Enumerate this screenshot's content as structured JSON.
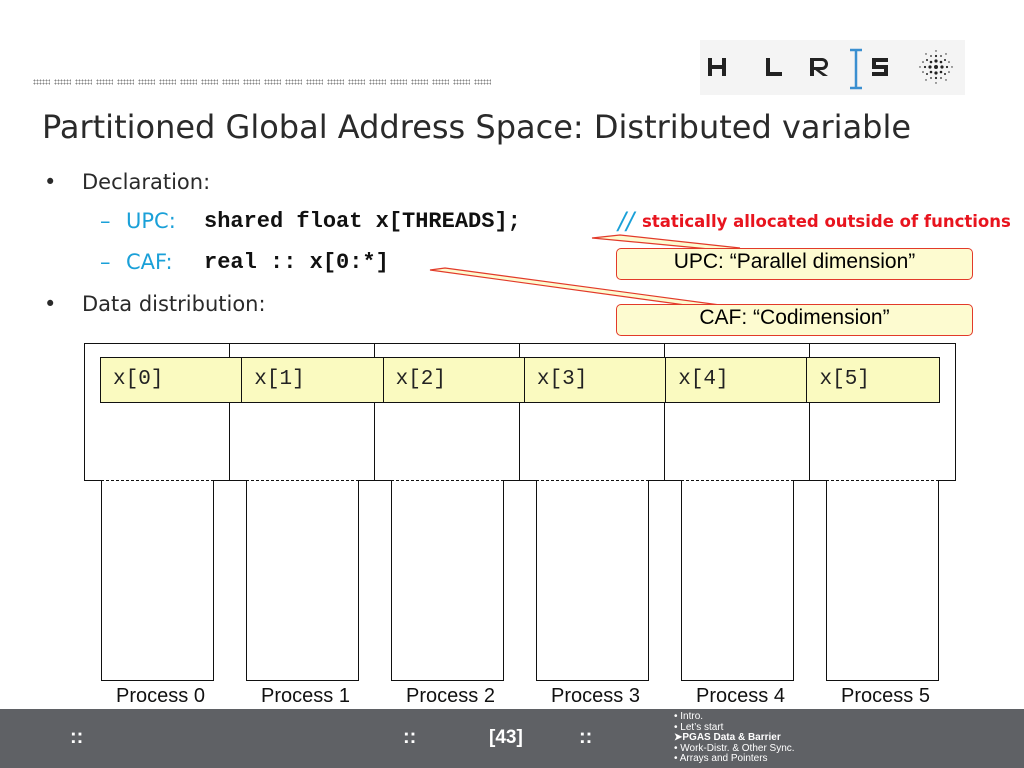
{
  "header": {
    "logo_text": "H L R | S"
  },
  "title": "Partitioned Global Address Space:  Distributed variable",
  "bullets": {
    "declaration": "Declaration:",
    "upc_label": "UPC:",
    "upc_code": "shared float x[THREADS];",
    "upc_comment_slashes": "//",
    "upc_comment_text": "statically allocated outside of functions",
    "caf_label": "CAF:",
    "caf_code": "real :: x[0:*]",
    "data_distribution": "Data distribution:"
  },
  "callouts": {
    "upc": "UPC: “Parallel dimension”",
    "caf": "CAF: “Codimension”"
  },
  "cells": [
    "x[0]",
    "x[1]",
    "x[2]",
    "x[3]",
    "x[4]",
    "x[5]"
  ],
  "processes": [
    "Process 0",
    "Process 1",
    "Process 2",
    "Process 3",
    "Process 4",
    "Process 5"
  ],
  "footer": {
    "nav_left": "::",
    "nav_mid": "::",
    "page": "[43]",
    "nav_right": "::",
    "toc": [
      "Intro.",
      "Let’s start",
      "PGAS Data & Barrier",
      "Work-Distr. & Other Sync.",
      "Arrays and Pointers"
    ],
    "toc_current": "PGAS Data & Barrier"
  },
  "colors": {
    "accent_blue": "#1aa0d8",
    "comment_red": "#e8141e",
    "callout_fill": "#fdfbd0",
    "band_fill": "#fafac0",
    "footer_bg": "#5f6165"
  }
}
